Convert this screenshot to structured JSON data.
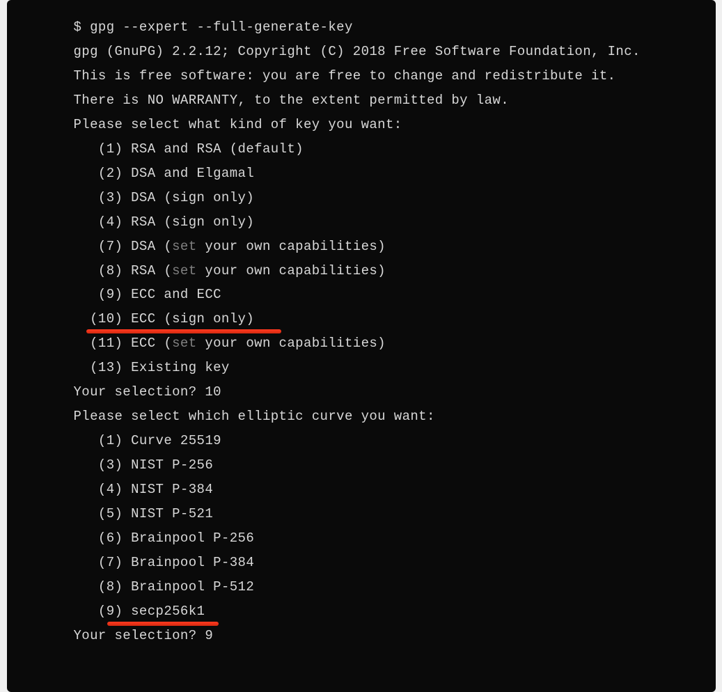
{
  "terminal": {
    "command": "$ gpg --expert --full-generate-key",
    "version_line": "gpg (GnuPG) 2.2.12; Copyright (C) 2018 Free Software Foundation, Inc.",
    "license_line1": "This is free software: you are free to change and redistribute it.",
    "license_line2": "There is NO WARRANTY, to the extent permitted by law.",
    "blank": "",
    "key_prompt": "Please select what kind of key you want:",
    "opt1": "   (1) RSA and RSA (default)",
    "opt2": "   (2) DSA and Elgamal",
    "opt3": "   (3) DSA (sign only)",
    "opt4": "   (4) RSA (sign only)",
    "opt7_prefix": "   (7) DSA (",
    "opt7_dim": "set",
    "opt7_suffix": " your own capabilities)",
    "opt8_prefix": "   (8) RSA (",
    "opt8_dim": "set",
    "opt8_suffix": " your own capabilities)",
    "opt9": "   (9) ECC and ECC",
    "opt10": "  (10) ECC (sign only)",
    "opt11_prefix": "  (11) ECC (",
    "opt11_dim": "set",
    "opt11_suffix": " your own capabilities)",
    "opt13": "  (13) Existing key",
    "selection1": "Your selection? 10",
    "curve_prompt": "Please select which elliptic curve you want:",
    "curve1": "   (1) Curve 25519",
    "curve3": "   (3) NIST P-256",
    "curve4": "   (4) NIST P-384",
    "curve5": "   (5) NIST P-521",
    "curve6": "   (6) Brainpool P-256",
    "curve7": "   (7) Brainpool P-384",
    "curve8": "   (8) Brainpool P-512",
    "curve9": "   (9) secp256k1",
    "selection2": "Your selection? 9"
  }
}
